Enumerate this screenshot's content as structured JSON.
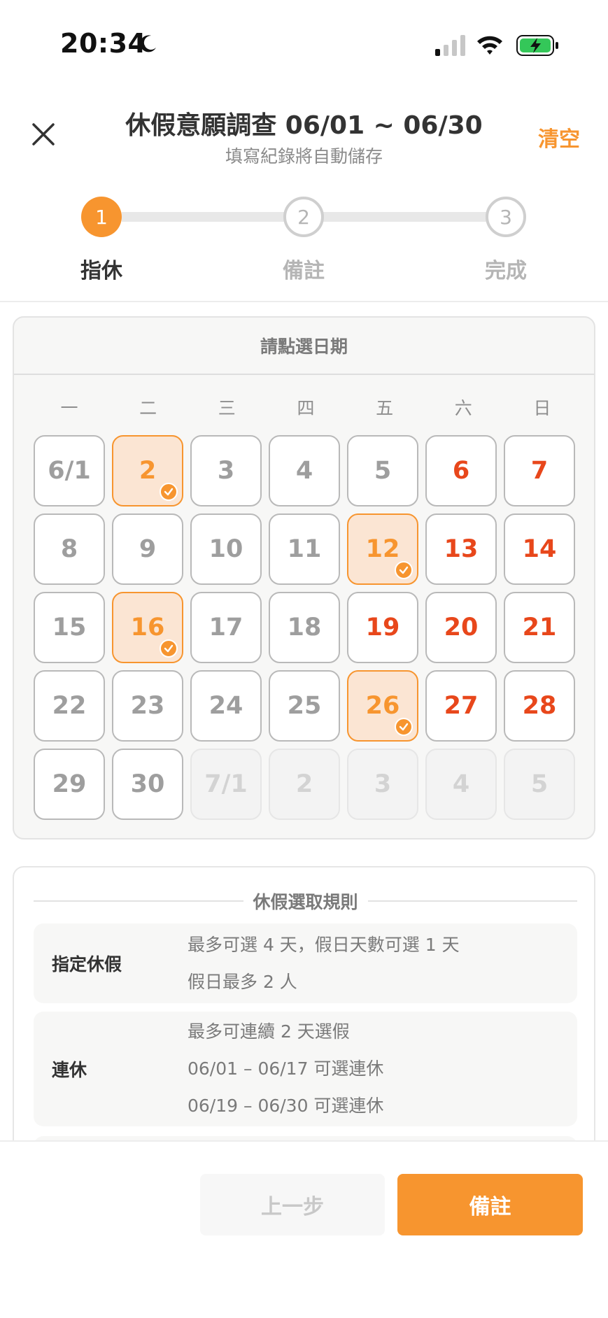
{
  "status_bar": {
    "time": "20:34"
  },
  "header": {
    "title": "休假意願調查 06/01 ~ 06/30",
    "subtitle": "填寫紀錄將自動儲存",
    "clear_label": "清空"
  },
  "stepper": {
    "steps": [
      {
        "number": "1",
        "label": "指休",
        "state": "active"
      },
      {
        "number": "2",
        "label": "備註",
        "state": "inactive"
      },
      {
        "number": "3",
        "label": "完成",
        "state": "inactive"
      }
    ]
  },
  "calendar": {
    "header": "請點選日期",
    "weekdays": [
      "一",
      "二",
      "三",
      "四",
      "五",
      "六",
      "日"
    ],
    "days": [
      {
        "label": "6/1",
        "state": "normal"
      },
      {
        "label": "2",
        "state": "selected"
      },
      {
        "label": "3",
        "state": "normal"
      },
      {
        "label": "4",
        "state": "normal"
      },
      {
        "label": "5",
        "state": "normal"
      },
      {
        "label": "6",
        "state": "weekend"
      },
      {
        "label": "7",
        "state": "weekend"
      },
      {
        "label": "8",
        "state": "normal"
      },
      {
        "label": "9",
        "state": "normal"
      },
      {
        "label": "10",
        "state": "normal"
      },
      {
        "label": "11",
        "state": "normal"
      },
      {
        "label": "12",
        "state": "selected"
      },
      {
        "label": "13",
        "state": "weekend"
      },
      {
        "label": "14",
        "state": "weekend"
      },
      {
        "label": "15",
        "state": "normal"
      },
      {
        "label": "16",
        "state": "selected"
      },
      {
        "label": "17",
        "state": "normal"
      },
      {
        "label": "18",
        "state": "normal"
      },
      {
        "label": "19",
        "state": "weekend"
      },
      {
        "label": "20",
        "state": "weekend"
      },
      {
        "label": "21",
        "state": "weekend"
      },
      {
        "label": "22",
        "state": "normal"
      },
      {
        "label": "23",
        "state": "normal"
      },
      {
        "label": "24",
        "state": "normal"
      },
      {
        "label": "25",
        "state": "normal"
      },
      {
        "label": "26",
        "state": "selected"
      },
      {
        "label": "27",
        "state": "weekend"
      },
      {
        "label": "28",
        "state": "weekend"
      },
      {
        "label": "29",
        "state": "normal"
      },
      {
        "label": "30",
        "state": "normal"
      },
      {
        "label": "7/1",
        "state": "disabled"
      },
      {
        "label": "2",
        "state": "disabled"
      },
      {
        "label": "3",
        "state": "disabled"
      },
      {
        "label": "4",
        "state": "disabled"
      },
      {
        "label": "5",
        "state": "disabled"
      }
    ]
  },
  "rules": {
    "title": "休假選取規則",
    "items": [
      {
        "name": "指定休假",
        "lines": [
          "最多可選 4 天，假日天數可選 1 天",
          "假日最多 2 人"
        ]
      },
      {
        "name": "連休",
        "lines": [
          "最多可連續 2 天選假",
          "06/01 – 06/17 可選連休",
          "06/19 – 06/30 可選連休"
        ]
      }
    ]
  },
  "footer": {
    "prev_label": "上一步",
    "next_label": "備註"
  },
  "colors": {
    "accent": "#f7952f",
    "weekend": "#e8471b",
    "selected_bg": "#fbe5d3",
    "battery": "#34c759"
  },
  "icons": {
    "close": "close-icon",
    "moon": "moon-icon",
    "signal": "cellular-signal-icon",
    "wifi": "wifi-icon",
    "battery": "battery-charging-icon",
    "check": "check-icon"
  }
}
